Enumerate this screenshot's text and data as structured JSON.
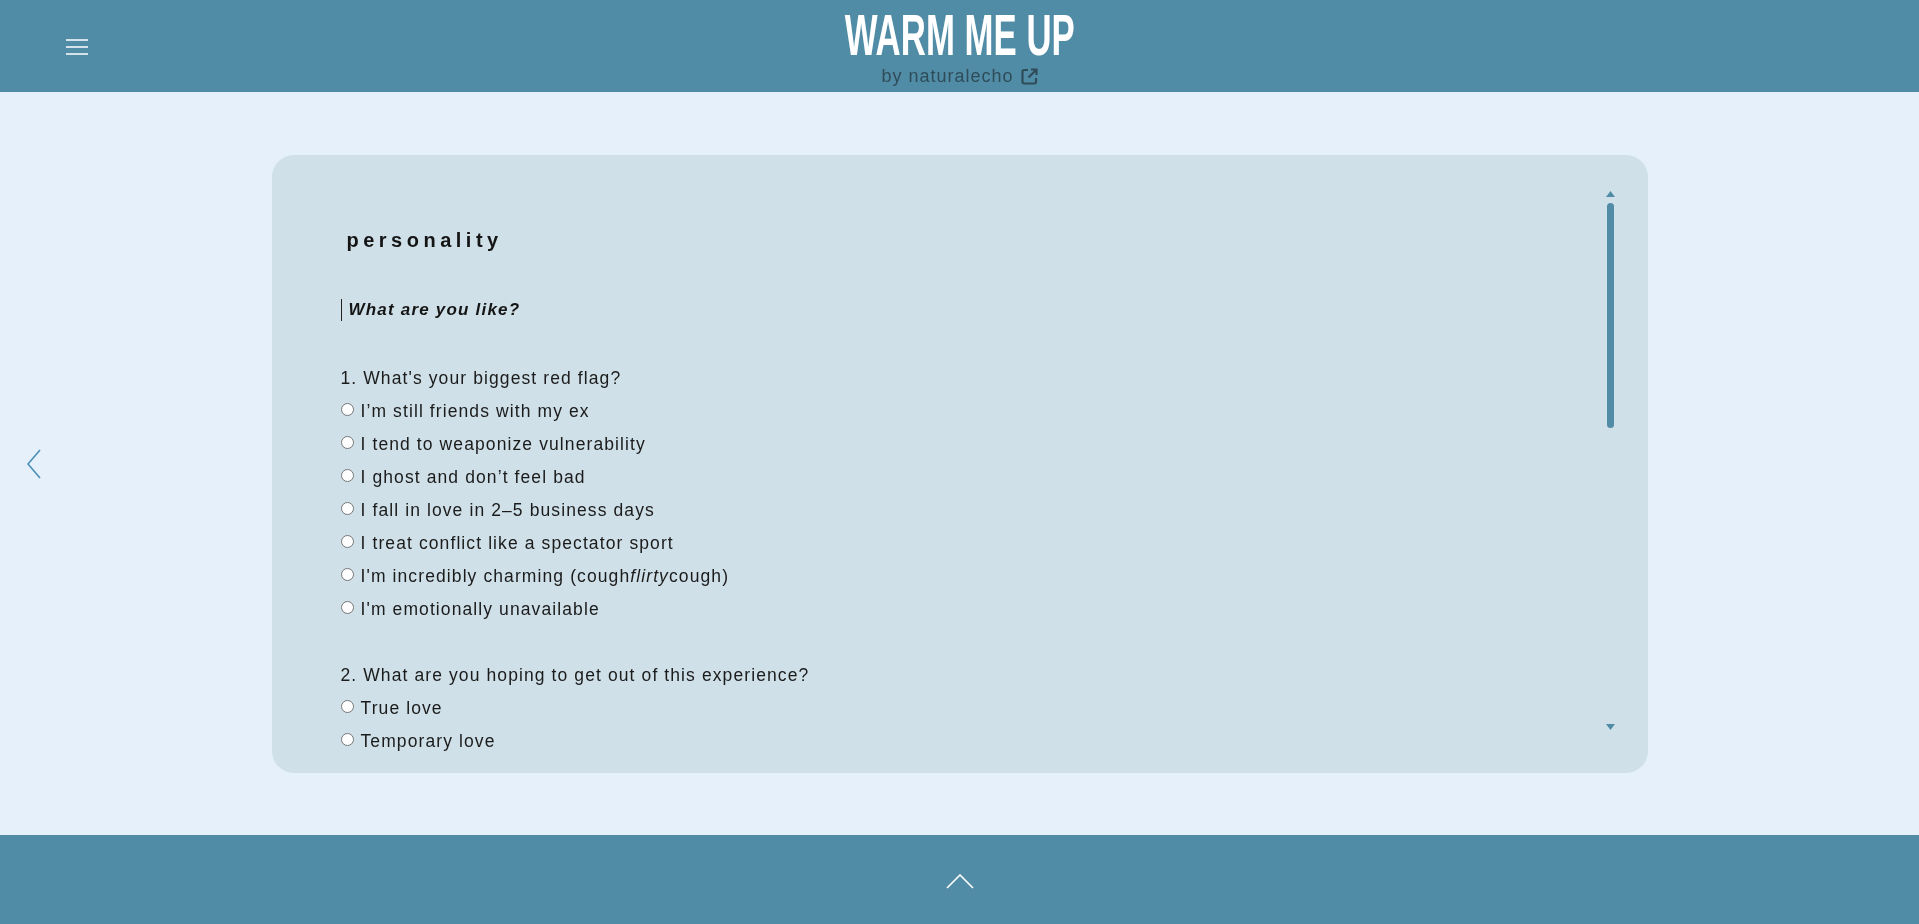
{
  "header": {
    "title": "WARM ME UP",
    "byline": "by naturalecho"
  },
  "section": {
    "heading": "personality",
    "subtitle": "What are you like?"
  },
  "questions": [
    {
      "text": "1. What's your biggest red flag?",
      "options": [
        {
          "label": "I’m still friends with my ex",
          "selected": false
        },
        {
          "label": "I tend to weaponize vulnerability",
          "selected": false
        },
        {
          "label": "I ghost and don’t feel bad",
          "selected": false
        },
        {
          "label": "I fall in love in 2–5 business days",
          "selected": false
        },
        {
          "label": "I treat conflict like a spectator sport",
          "selected": false
        },
        {
          "label": "I'm incredibly charming (cough",
          "label_italic": "flirty",
          "label_after": "cough)",
          "selected": false
        },
        {
          "label": "I'm emotionally unavailable",
          "selected": false
        }
      ]
    },
    {
      "text": "2. What are you hoping to get out of this experience?",
      "options": [
        {
          "label": "True love",
          "selected": false
        },
        {
          "label": "Temporary love",
          "selected": false
        }
      ]
    }
  ]
}
